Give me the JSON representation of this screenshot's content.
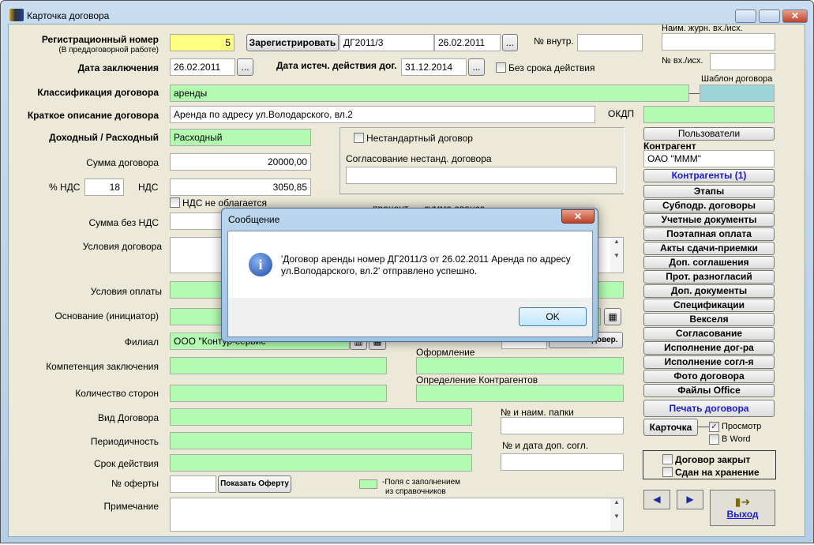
{
  "window": {
    "title": "Карточка договора"
  },
  "form": {
    "reg_label": "Регистрационный номер",
    "reg_sublabel": "(В преддоговорной работе)",
    "reg_value": "5",
    "register_button": "Зарегистрировать",
    "contract_number": "ДГ2011/3",
    "reg_date": "26.02.2011",
    "dots": "...",
    "internal_no_label": "№ внутр.",
    "internal_no": "",
    "journal_label": "Наим. журн. вх./исх.",
    "journal": "",
    "inout_no_label": "№ вх./исх.",
    "inout_no": "",
    "conclusion_date_label": "Дата заключения",
    "conclusion_date": "26.02.2011",
    "expiry_label": "Дата истеч. действия дог.",
    "expiry_date": "31.12.2014",
    "no_term_label": "Без срока действия",
    "template_label": "Шаблон договора",
    "classification_label": "Классификация договора",
    "classification": "аренды",
    "description_label": "Краткое описание договора",
    "description": "Аренда по адресу ул.Володарского, вл.2",
    "okdp_label": "ОКДП",
    "okdp": "",
    "income_label": "Доходный / Расходный",
    "income": "Расходный",
    "nonstandard_label": "Нестандартный договор",
    "nonstandard_approval_label": "Согласование нестанд. договора",
    "sum_label": "Сумма договора",
    "sum": "20000,00",
    "vat_pct_label": "% НДС",
    "vat_pct": "18",
    "vat_label": "НДС",
    "vat": "3050,85",
    "no_vat_label": "НДС не облагается",
    "sum_no_vat_label": "Сумма без НДС",
    "percent_label": "процент",
    "advance_label": "сумма аванса",
    "terms_label": "Условия договора",
    "payment_terms_label": "Условия оплаты",
    "basis_label": "Основание (инициатор)",
    "branch_label": "Филиал",
    "branch": "ООО \"Контур-сервис\"",
    "show_power_button": "Показать довер.",
    "competence_label": "Компетенция заключения",
    "formalization_label": "Оформление",
    "parties_label": "Количество сторон",
    "counterparty_def_label": "Определение Контрагентов",
    "kind_label": "Вид Договора",
    "folder_label": "№ и наим. папки",
    "periodicity_label": "Периодичность",
    "term_label": "Срок действия",
    "addendum_label": "№ и дата доп. согл.",
    "offer_label": "№ оферты",
    "show_offer_button": "Показать Оферту",
    "legend_line1": "-Поля с заполнением",
    "legend_line2": "из справочников",
    "note_label": "Примечание"
  },
  "right": {
    "users_button": "Пользователи",
    "counterparty_label": "Контрагент",
    "counterparty": "ОАО \"МММ\"",
    "buttons": [
      "Контрагенты (1)",
      "Этапы",
      "Субподр. договоры",
      "Учетные документы",
      "Поэтапная оплата",
      "Акты сдачи-приемки",
      "Доп. соглашения",
      "Прот. разногласий",
      "Доп. документы",
      "Спецификации",
      "Векселя",
      "Согласование",
      "Исполнение дог-ра",
      "Исполнение согл-я",
      "Фото договора",
      "Файлы Office"
    ],
    "print_button": "Печать договора",
    "card_button": "Карточка",
    "preview_label": "Просмотр",
    "preview_checked": true,
    "word_label": "В Word",
    "word_checked": false,
    "closed_label": "Договор закрыт",
    "archived_label": "Сдан на хранение",
    "exit_label": "Выход"
  },
  "dialog": {
    "title": "Сообщение",
    "message_line1": "'Договор аренды номер ДГ2011/3 от 26.02.2011 Аренда по адресу",
    "message_line2": "ул.Володарского, вл.2' отправлено успешно.",
    "ok_button": "OK"
  }
}
